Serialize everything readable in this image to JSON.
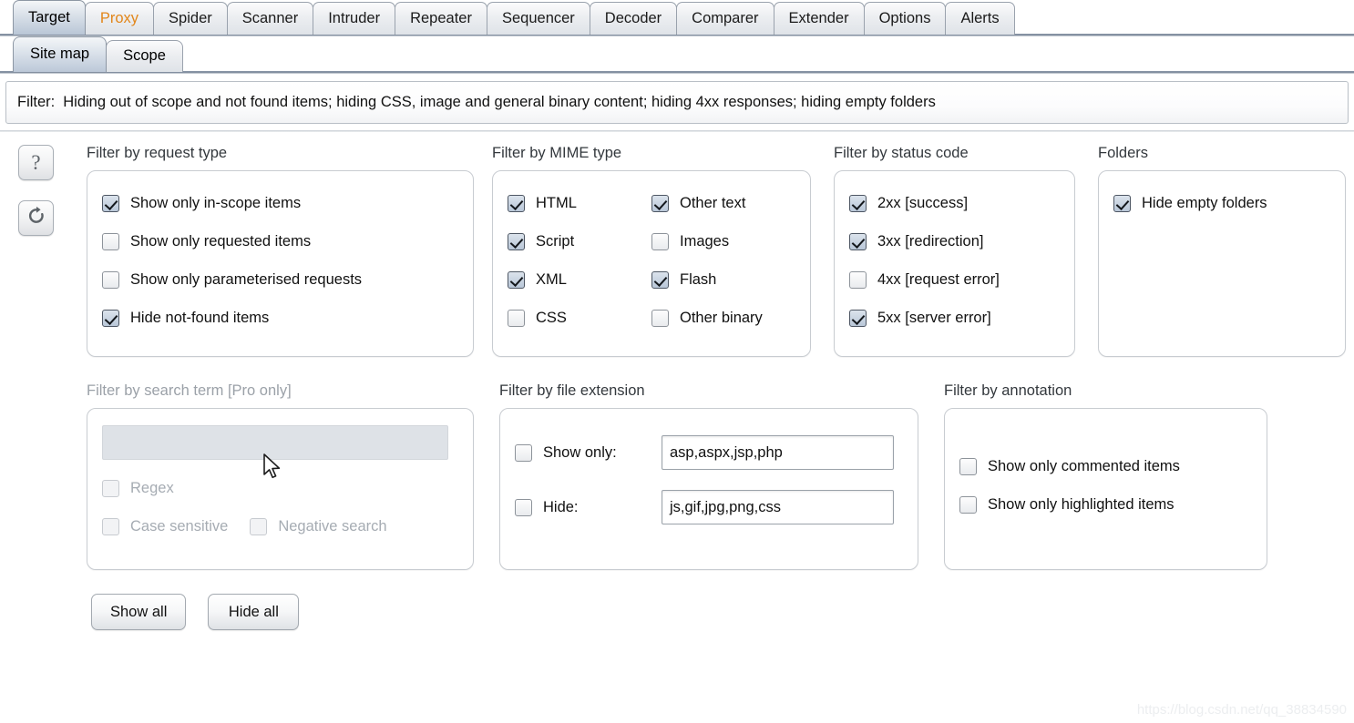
{
  "main_tabs": [
    {
      "label": "Target",
      "selected": true,
      "accent": false
    },
    {
      "label": "Proxy",
      "selected": false,
      "accent": true
    },
    {
      "label": "Spider",
      "selected": false,
      "accent": false
    },
    {
      "label": "Scanner",
      "selected": false,
      "accent": false
    },
    {
      "label": "Intruder",
      "selected": false,
      "accent": false
    },
    {
      "label": "Repeater",
      "selected": false,
      "accent": false
    },
    {
      "label": "Sequencer",
      "selected": false,
      "accent": false
    },
    {
      "label": "Decoder",
      "selected": false,
      "accent": false
    },
    {
      "label": "Comparer",
      "selected": false,
      "accent": false
    },
    {
      "label": "Extender",
      "selected": false,
      "accent": false
    },
    {
      "label": "Options",
      "selected": false,
      "accent": false
    },
    {
      "label": "Alerts",
      "selected": false,
      "accent": false
    }
  ],
  "sub_tabs": [
    {
      "label": "Site map",
      "selected": true
    },
    {
      "label": "Scope",
      "selected": false
    }
  ],
  "filter_bar": {
    "label": "Filter:",
    "summary": "Hiding out of scope and not found items;  hiding CSS, image and general binary content;  hiding 4xx responses;  hiding empty folders"
  },
  "side_buttons": [
    {
      "name": "help",
      "glyph": "?"
    },
    {
      "name": "refresh",
      "glyph": "refresh-arrow"
    }
  ],
  "groups": {
    "request_type": {
      "title": "Filter by request type",
      "items": [
        {
          "label": "Show only in-scope items",
          "checked": true
        },
        {
          "label": "Show only requested items",
          "checked": false
        },
        {
          "label": "Show only parameterised requests",
          "checked": false
        },
        {
          "label": "Hide not-found items",
          "checked": true
        }
      ]
    },
    "mime_type": {
      "title": "Filter by MIME type",
      "left": [
        {
          "label": "HTML",
          "checked": true
        },
        {
          "label": "Script",
          "checked": true
        },
        {
          "label": "XML",
          "checked": true
        },
        {
          "label": "CSS",
          "checked": false
        }
      ],
      "right": [
        {
          "label": "Other text",
          "checked": true
        },
        {
          "label": "Images",
          "checked": false
        },
        {
          "label": "Flash",
          "checked": true
        },
        {
          "label": "Other binary",
          "checked": false
        }
      ]
    },
    "status_code": {
      "title": "Filter by status code",
      "items": [
        {
          "label": "2xx  [success]",
          "checked": true
        },
        {
          "label": "3xx  [redirection]",
          "checked": true
        },
        {
          "label": "4xx  [request error]",
          "checked": false
        },
        {
          "label": "5xx  [server error]",
          "checked": true
        }
      ]
    },
    "folders": {
      "title": "Folders",
      "items": [
        {
          "label": "Hide empty folders",
          "checked": true
        }
      ]
    },
    "search_term": {
      "title": "Filter by search term [Pro only]",
      "disabled": true,
      "input_value": "",
      "input_placeholder": "",
      "items": [
        {
          "label": "Regex",
          "checked": false
        },
        {
          "label": "Case sensitive",
          "checked": false
        },
        {
          "label": "Negative search",
          "checked": false
        }
      ]
    },
    "file_extension": {
      "title": "Filter by file extension",
      "rows": [
        {
          "label": "Show only:",
          "checked": false,
          "value": "asp,aspx,jsp,php"
        },
        {
          "label": "Hide:",
          "checked": false,
          "value": "js,gif,jpg,png,css"
        }
      ]
    },
    "annotation": {
      "title": "Filter by annotation",
      "items": [
        {
          "label": "Show only commented items",
          "checked": false
        },
        {
          "label": "Show only highlighted items",
          "checked": false
        }
      ]
    }
  },
  "buttons": [
    {
      "label": "Show all"
    },
    {
      "label": "Hide all"
    }
  ],
  "watermark": "https://blog.csdn.net/qq_38834590",
  "colors": {
    "accent_tab": "#e2861a",
    "selected_tab": "#b9c6d6",
    "panel_border": "#c8ccd1",
    "disabled_text": "#a6acb3"
  }
}
